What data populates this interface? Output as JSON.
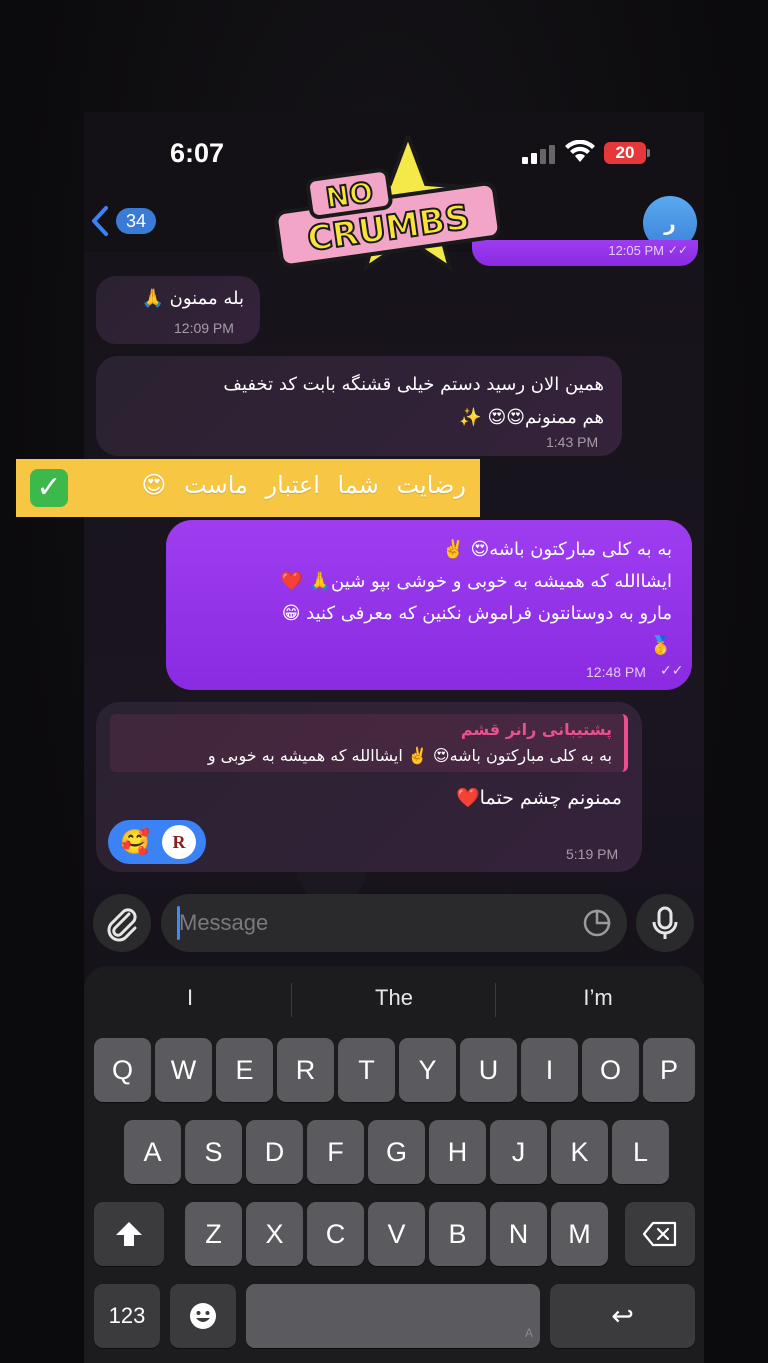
{
  "status_bar": {
    "time": "6:07",
    "battery": "20"
  },
  "header": {
    "back_count": "34",
    "avatar_letter": "ر"
  },
  "sticker": {
    "line1": "NO",
    "line2": "CRUMBS"
  },
  "messages": {
    "top": {
      "time": "12:05 PM"
    },
    "m1": {
      "text": "بله ممنون 🙏",
      "time": "12:09 PM"
    },
    "m2": {
      "line1": "همین الان رسید دستم خیلی قشنگه بابت کد تخفیف",
      "line2": "هم ممنونم😍😍 ✨",
      "time": "1:43 PM"
    },
    "banner": {
      "text": "رضایت شما اعتبار ماست 😍"
    },
    "m3": {
      "line1": "به به کلی مبارکتون باشه😍 ✌️",
      "line2": "ایشاالله که همیشه به خوبی و خوشی بپو شین🙏 ❤️",
      "line3": "مارو به دوستانتون فراموش نکنین که معرفی کنید 😁",
      "line4": "🥇",
      "time": "12:48 PM"
    },
    "m4": {
      "reply_name": "پشتیبانی رانر قشم",
      "reply_text": "به به کلی مبارکتون باشه😍 ✌️ ایشاالله که همیشه به خوبی و",
      "text": "ممنونم چشم حتما❤️",
      "reaction_emoji": "🥰",
      "reaction_avatar": "R",
      "time": "5:19 PM"
    }
  },
  "input": {
    "placeholder": "Message"
  },
  "keyboard": {
    "suggestions": [
      "I",
      "The",
      "I’m"
    ],
    "row1": [
      "Q",
      "W",
      "E",
      "R",
      "T",
      "Y",
      "U",
      "I",
      "O",
      "P"
    ],
    "row2": [
      "A",
      "S",
      "D",
      "F",
      "G",
      "H",
      "J",
      "K",
      "L"
    ],
    "row3": [
      "Z",
      "X",
      "C",
      "V",
      "B",
      "N",
      "M"
    ],
    "numbers_label": "123",
    "return_symbol": "↩",
    "space_hint": "A"
  },
  "colors": {
    "outgoing": "#9e3df0",
    "incoming": "#2a2230",
    "accent": "#3b82f6",
    "banner": "#f7c744"
  }
}
